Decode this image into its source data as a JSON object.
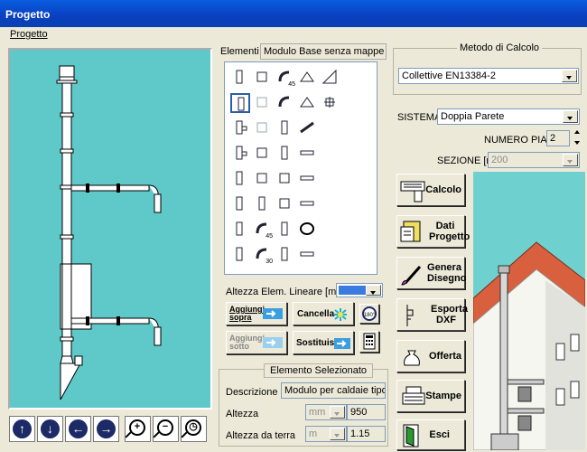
{
  "window": {
    "title": "Progetto"
  },
  "menu": {
    "items": [
      "Progetto"
    ]
  },
  "elementi": {
    "label": "Elementi",
    "value": "Modulo Base senza mappe"
  },
  "metodo": {
    "title": "Metodo di Calcolo",
    "value": "Collettive EN13384-2"
  },
  "sistema": {
    "label": "SISTEMA",
    "value": "Doppia Parete"
  },
  "numero_piani": {
    "label": "NUMERO PIANI",
    "value": "2"
  },
  "sezione": {
    "label": "SEZIONE [mm]",
    "value": "200"
  },
  "altezza_lineare": {
    "label": "Altezza Elem. Lineare [mm]"
  },
  "actions": {
    "aggiungi": "Aggiungi sopra",
    "cancella": "Cancella",
    "ruota": "180°",
    "aggiungi_sotto": "Aggiungi sotto",
    "sostituisci": "Sostituisci"
  },
  "selezionato": {
    "title": "Elemento Selezionato",
    "descrizione_label": "Descrizione",
    "descrizione_value": "Modulo per caldaie tipo-C",
    "altezza_label": "Altezza",
    "altezza_unit": "mm",
    "altezza_value": "950",
    "altezza_terra_label": "Altezza da terra",
    "altezza_terra_unit": "m",
    "altezza_terra_value": "1.15"
  },
  "side_buttons": {
    "calcolo": "Calcolo",
    "dati_progetto": "Dati Progetto",
    "genera_disegno": "Genera Disegno",
    "esporta_dxf": "Esporta DXF",
    "offerta": "Offerta",
    "stampe": "Stampe",
    "esci": "Esci"
  },
  "palette_labels": {
    "r1c3": "45",
    "r6c2": "45",
    "r7c2": "30"
  },
  "colors": {
    "titlebar": "#0a4fd0",
    "canvas": "#5fc8c8",
    "accent_blue": "#3a7be0"
  }
}
